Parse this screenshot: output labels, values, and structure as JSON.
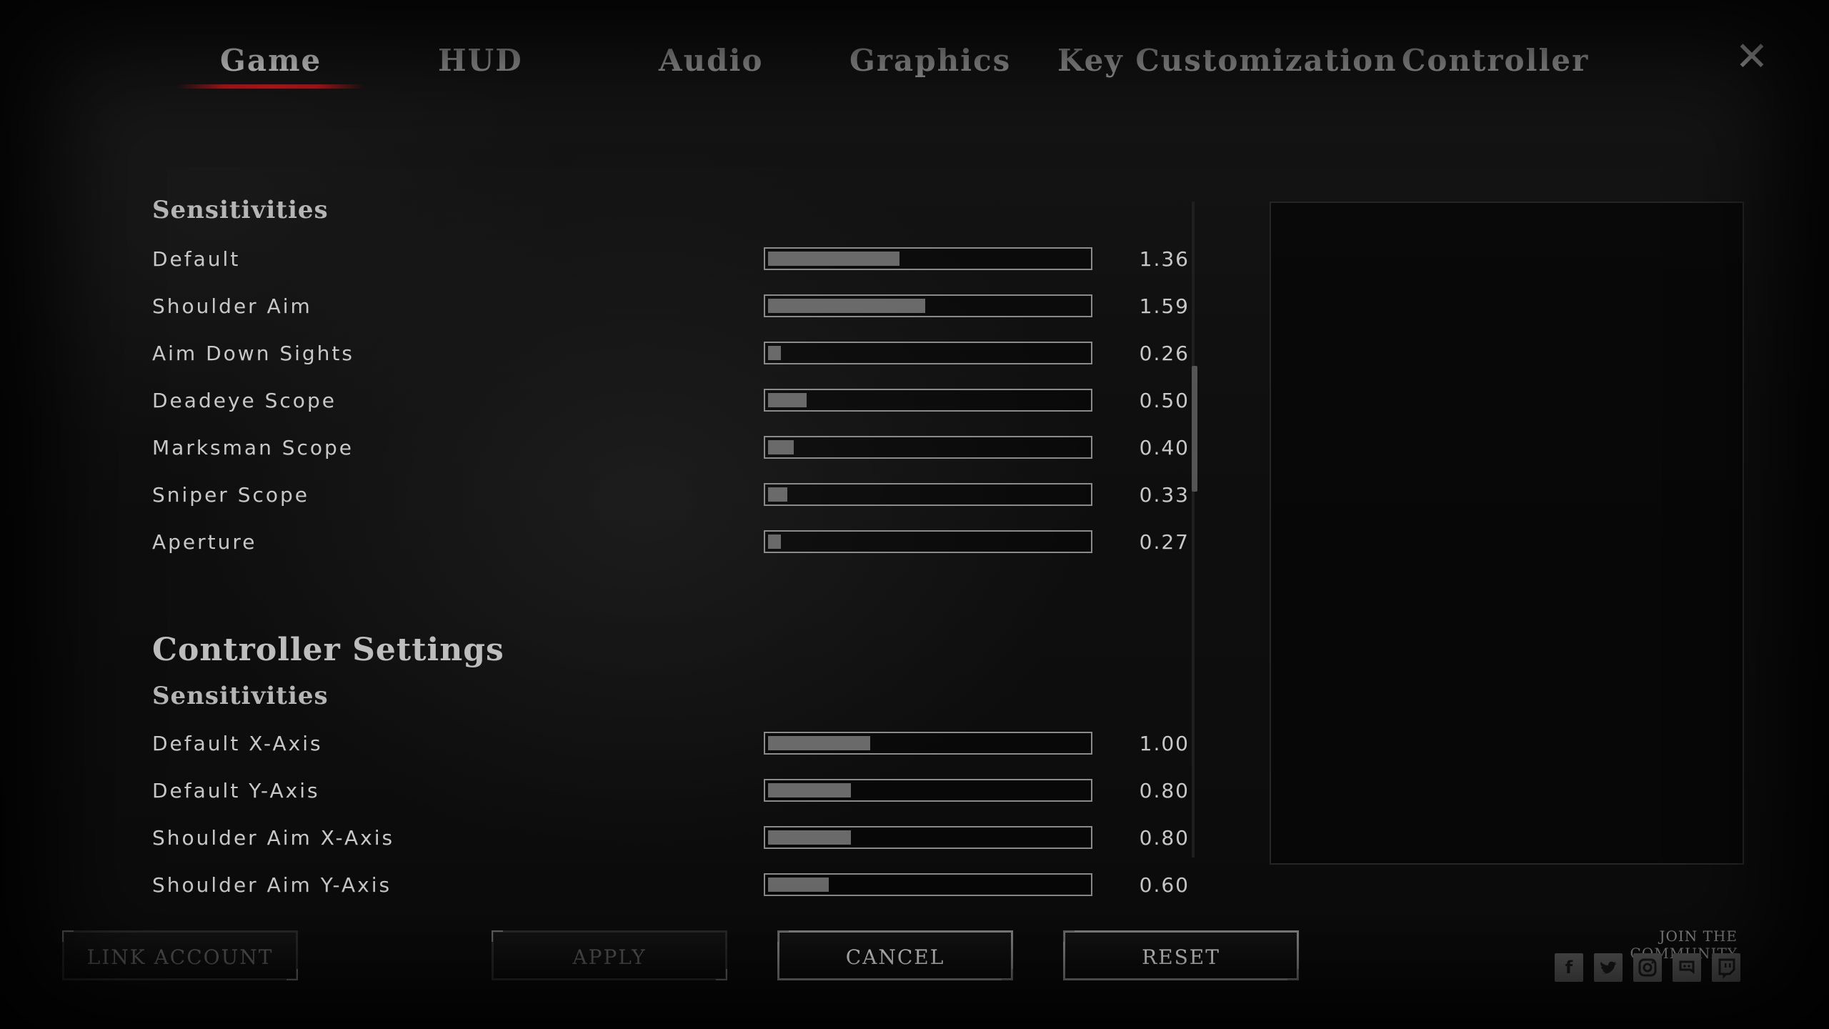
{
  "tabs": [
    {
      "label": "Game",
      "active": true
    },
    {
      "label": "HUD",
      "active": false
    },
    {
      "label": "Audio",
      "active": false
    },
    {
      "label": "Graphics",
      "active": false
    },
    {
      "label": "Key Customization",
      "active": false
    },
    {
      "label": "Controller",
      "active": false
    }
  ],
  "close_icon": "close-icon",
  "mouse_section": {
    "heading": "Sensitivities",
    "rows": [
      {
        "label": "Default",
        "value": "1.36",
        "fill": 0.41
      },
      {
        "label": "Shoulder Aim",
        "value": "1.59",
        "fill": 0.49
      },
      {
        "label": "Aim Down Sights",
        "value": "0.26",
        "fill": 0.04
      },
      {
        "label": "Deadeye Scope",
        "value": "0.50",
        "fill": 0.12
      },
      {
        "label": "Marksman Scope",
        "value": "0.40",
        "fill": 0.08
      },
      {
        "label": "Sniper Scope",
        "value": "0.33",
        "fill": 0.06
      },
      {
        "label": "Aperture",
        "value": "0.27",
        "fill": 0.04
      }
    ]
  },
  "controller_section": {
    "title": "Controller Settings",
    "heading": "Sensitivities",
    "rows": [
      {
        "label": "Default X-Axis",
        "value": "1.00",
        "fill": 0.32
      },
      {
        "label": "Default Y-Axis",
        "value": "0.80",
        "fill": 0.26
      },
      {
        "label": "Shoulder Aim X-Axis",
        "value": "0.80",
        "fill": 0.26
      },
      {
        "label": "Shoulder Aim Y-Axis",
        "value": "0.60",
        "fill": 0.19
      }
    ]
  },
  "buttons": {
    "link_account": "LINK ACCOUNT",
    "apply": "APPLY",
    "cancel": "CANCEL",
    "reset": "RESET"
  },
  "community": {
    "label": "JOIN THE COMMUNITY",
    "icons": [
      "facebook-icon",
      "twitter-icon",
      "instagram-icon",
      "discord-icon",
      "twitch-icon"
    ]
  },
  "colors": {
    "accent_red": "#c4161c",
    "text": "#c8c8c8",
    "slider_fill": "#6a6a6a"
  }
}
